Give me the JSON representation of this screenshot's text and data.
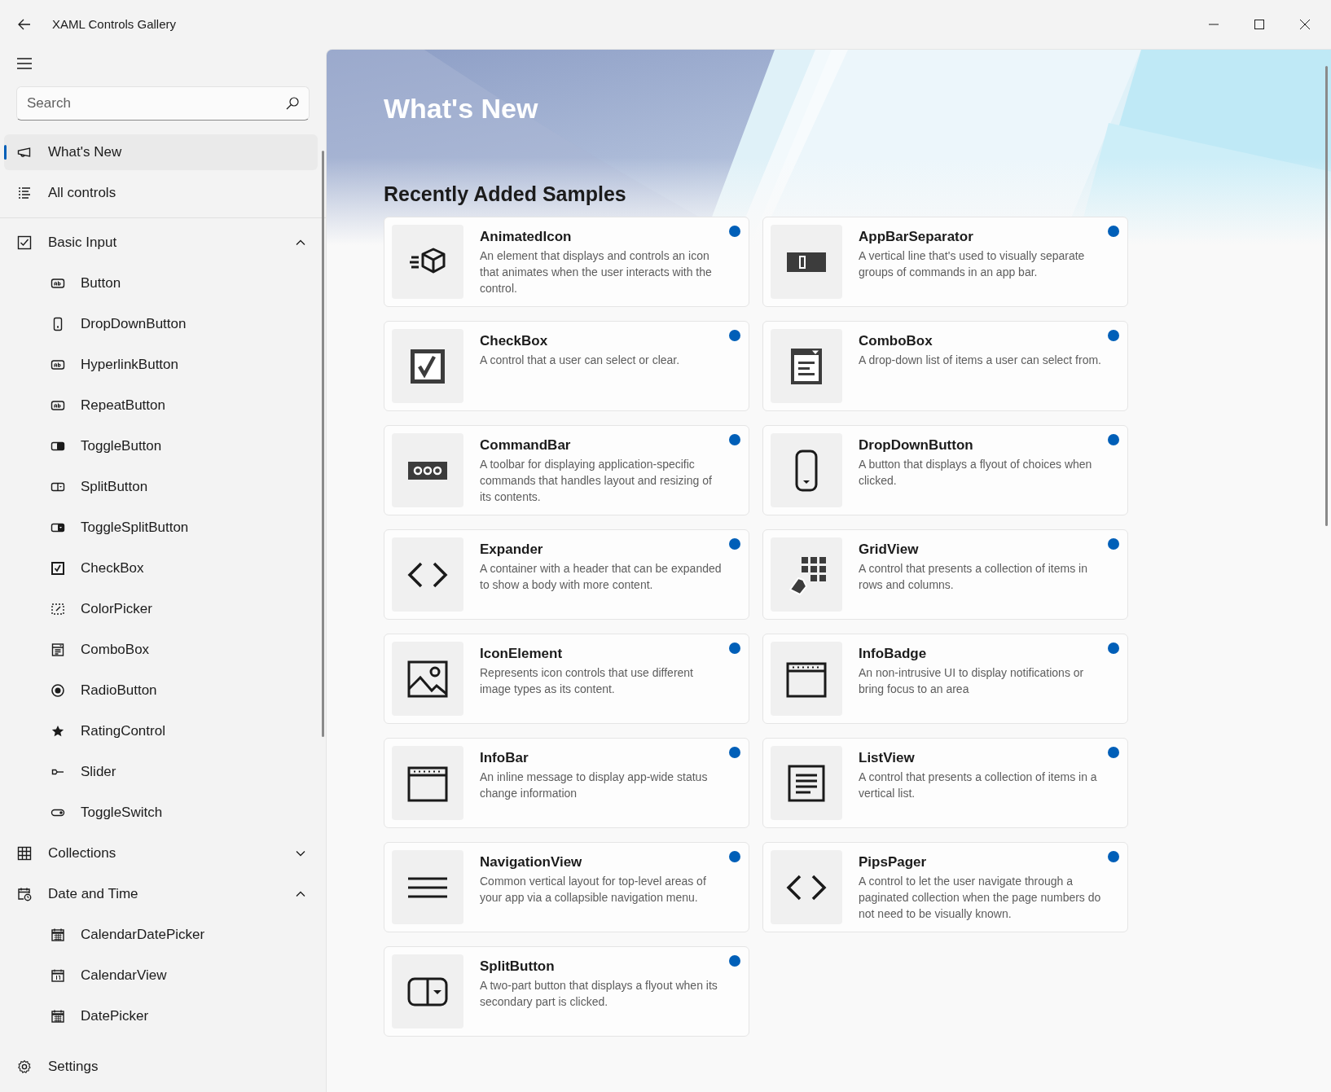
{
  "window": {
    "title": "XAML Controls Gallery"
  },
  "search": {
    "placeholder": "Search"
  },
  "nav": {
    "items": [
      {
        "label": "What's New",
        "selected": true
      },
      {
        "label": "All controls",
        "selected": false
      }
    ],
    "groups": [
      {
        "label": "Basic Input",
        "expanded": true,
        "children": [
          {
            "label": "Button",
            "selected": false
          },
          {
            "label": "DropDownButton",
            "selected": false
          },
          {
            "label": "HyperlinkButton",
            "selected": false
          },
          {
            "label": "RepeatButton",
            "selected": false
          },
          {
            "label": "ToggleButton",
            "selected": false
          },
          {
            "label": "SplitButton",
            "selected": false
          },
          {
            "label": "ToggleSplitButton",
            "selected": false
          },
          {
            "label": "CheckBox",
            "selected": false
          },
          {
            "label": "ColorPicker",
            "selected": false
          },
          {
            "label": "ComboBox",
            "selected": false
          },
          {
            "label": "RadioButton",
            "selected": false
          },
          {
            "label": "RatingControl",
            "selected": false
          },
          {
            "label": "Slider",
            "selected": false
          },
          {
            "label": "ToggleSwitch",
            "selected": false
          }
        ]
      },
      {
        "label": "Collections",
        "expanded": false
      },
      {
        "label": "Date and Time",
        "expanded": true,
        "children": [
          {
            "label": "CalendarDatePicker",
            "selected": false
          },
          {
            "label": "CalendarView",
            "selected": false
          },
          {
            "label": "DatePicker",
            "selected": false
          }
        ]
      }
    ],
    "footer": {
      "label": "Settings",
      "selected": false
    }
  },
  "page": {
    "title": "What's New",
    "section": "Recently Added Samples"
  },
  "cards": [
    {
      "title": "AnimatedIcon",
      "description": "An element that displays and controls an icon that animates when the user interacts with the control.",
      "new": true
    },
    {
      "title": "AppBarSeparator",
      "description": "A vertical line that's used to visually separate groups of commands in an app bar.",
      "new": true
    },
    {
      "title": "CheckBox",
      "description": "A control that a user can select or clear.",
      "new": true
    },
    {
      "title": "ComboBox",
      "description": "A drop-down list of items a user can select from.",
      "new": true
    },
    {
      "title": "CommandBar",
      "description": "A toolbar for displaying application-specific commands that handles layout and resizing of its contents.",
      "new": true
    },
    {
      "title": "DropDownButton",
      "description": "A button that displays a flyout of choices when clicked.",
      "new": true
    },
    {
      "title": "Expander",
      "description": "A container with a header that can be expanded to show a body with more content.",
      "new": true
    },
    {
      "title": "GridView",
      "description": "A control that presents a collection of items in rows and columns.",
      "new": true
    },
    {
      "title": "IconElement",
      "description": "Represents icon controls that use different image types as its content.",
      "new": true
    },
    {
      "title": "InfoBadge",
      "description": "An non-intrusive UI to display notifications or bring focus to an area",
      "new": true
    },
    {
      "title": "InfoBar",
      "description": "An inline message to display app-wide status change information",
      "new": true
    },
    {
      "title": "ListView",
      "description": "A control that presents a collection of items in a vertical list.",
      "new": true
    },
    {
      "title": "NavigationView",
      "description": "Common vertical layout for top-level areas of your app via a collapsible navigation menu.",
      "new": true
    },
    {
      "title": "PipsPager",
      "description": "A control to let the user navigate through a paginated collection when the page numbers do not need to be visually known.",
      "new": true
    },
    {
      "title": "SplitButton",
      "description": "A two-part button that displays a flyout when its secondary part is clicked.",
      "new": true
    }
  ]
}
